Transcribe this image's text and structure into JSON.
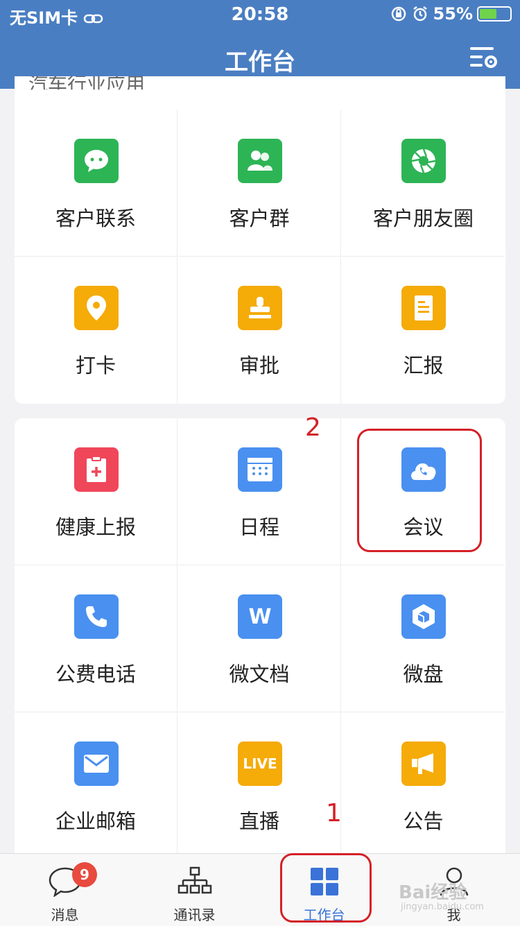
{
  "status": {
    "carrier": "无SIM卡",
    "time": "20:58",
    "battery": "55%"
  },
  "header": {
    "title": "工作台"
  },
  "section1": {
    "title": "汽车行业应用",
    "items": [
      {
        "label": "客户联系",
        "icon": "chat-icon",
        "color": "#2db455"
      },
      {
        "label": "客户群",
        "icon": "group-icon",
        "color": "#2db455"
      },
      {
        "label": "客户朋友圈",
        "icon": "aperture-icon",
        "color": "#2db455"
      },
      {
        "label": "打卡",
        "icon": "location-icon",
        "color": "#f5ab08"
      },
      {
        "label": "审批",
        "icon": "stamp-icon",
        "color": "#f5ab08"
      },
      {
        "label": "汇报",
        "icon": "report-icon",
        "color": "#f5ab08"
      }
    ]
  },
  "section2": {
    "items": [
      {
        "label": "健康上报",
        "icon": "health-report-icon",
        "color": "#f0465a"
      },
      {
        "label": "日程",
        "icon": "calendar-icon",
        "color": "#4a90f0"
      },
      {
        "label": "会议",
        "icon": "cloud-phone-icon",
        "color": "#4a90f0"
      },
      {
        "label": "公费电话",
        "icon": "phone-icon",
        "color": "#4a90f0"
      },
      {
        "label": "微文档",
        "icon": "word-doc-icon",
        "color": "#4a90f0"
      },
      {
        "label": "微盘",
        "icon": "cube-icon",
        "color": "#4a90f0"
      },
      {
        "label": "企业邮箱",
        "icon": "mail-icon",
        "color": "#4a90f0"
      },
      {
        "label": "直播",
        "icon": "live-icon",
        "color": "#f5ab08"
      },
      {
        "label": "公告",
        "icon": "megaphone-icon",
        "color": "#f5ab08"
      }
    ],
    "live_text": "LIVE",
    "word_text": "W"
  },
  "tabbar": {
    "tabs": [
      {
        "label": "消息",
        "badge": "9"
      },
      {
        "label": "通讯录"
      },
      {
        "label": "工作台"
      },
      {
        "label": "我"
      }
    ],
    "active_color": "#3a72d8"
  },
  "annotations": {
    "mark1": "1",
    "mark2": "2"
  },
  "watermark": {
    "text": "Bai经验",
    "url": "jingyan.baidu.com"
  }
}
